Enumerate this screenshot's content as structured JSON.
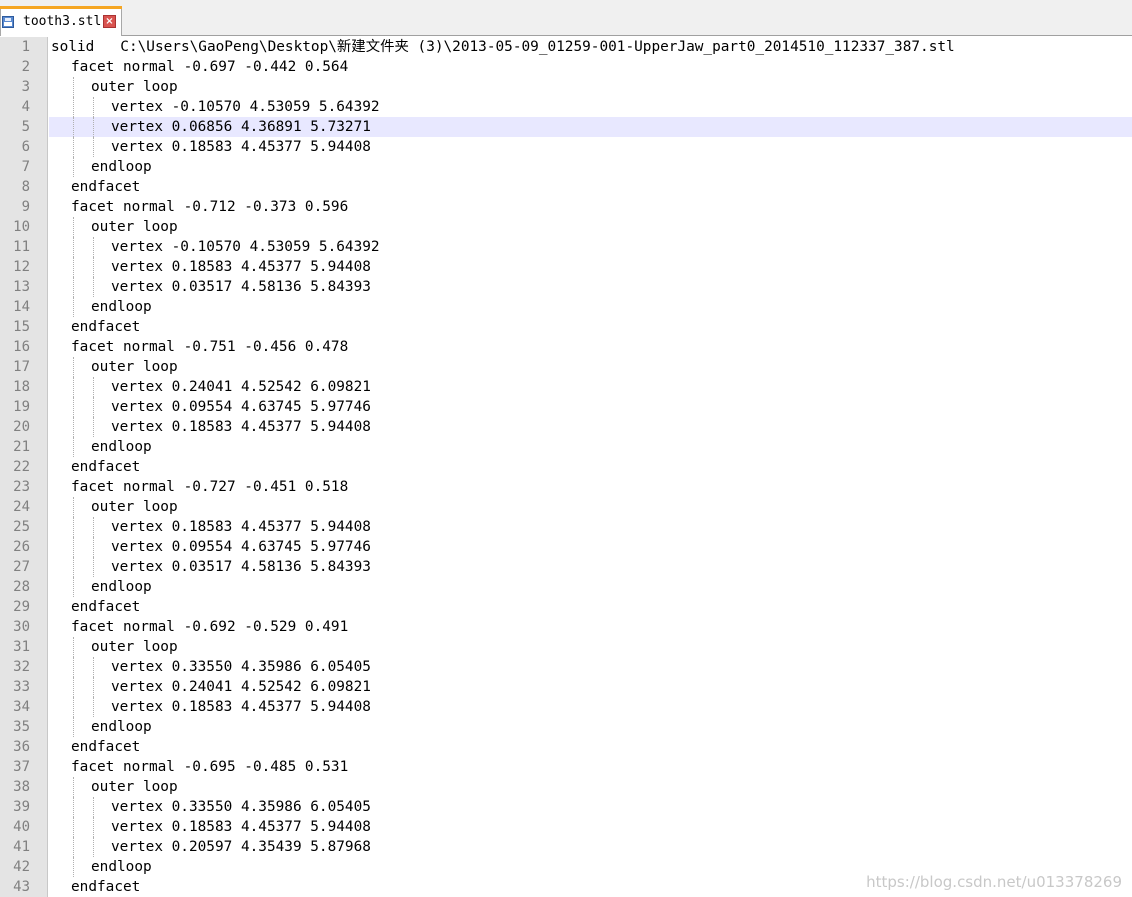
{
  "tab": {
    "label": "tooth3.stl",
    "save_icon": "save-icon",
    "close_icon": "close-icon",
    "accent_color": "#f5a623"
  },
  "editor": {
    "current_line": 5,
    "lines": [
      {
        "n": "1",
        "indent": 0,
        "text": "solid   C:\\Users\\GaoPeng\\Desktop\\新建文件夹 (3)\\2013-05-09_01259-001-UpperJaw_part0_2014510_112337_387.stl"
      },
      {
        "n": "2",
        "indent": 1,
        "text": "facet normal -0.697 -0.442 0.564"
      },
      {
        "n": "3",
        "indent": 2,
        "text": "outer loop"
      },
      {
        "n": "4",
        "indent": 3,
        "text": "vertex -0.10570 4.53059 5.64392"
      },
      {
        "n": "5",
        "indent": 3,
        "text": "vertex 0.06856 4.36891 5.73271"
      },
      {
        "n": "6",
        "indent": 3,
        "text": "vertex 0.18583 4.45377 5.94408"
      },
      {
        "n": "7",
        "indent": 2,
        "text": "endloop"
      },
      {
        "n": "8",
        "indent": 1,
        "text": "endfacet"
      },
      {
        "n": "9",
        "indent": 1,
        "text": "facet normal -0.712 -0.373 0.596"
      },
      {
        "n": "10",
        "indent": 2,
        "text": "outer loop"
      },
      {
        "n": "11",
        "indent": 3,
        "text": "vertex -0.10570 4.53059 5.64392"
      },
      {
        "n": "12",
        "indent": 3,
        "text": "vertex 0.18583 4.45377 5.94408"
      },
      {
        "n": "13",
        "indent": 3,
        "text": "vertex 0.03517 4.58136 5.84393"
      },
      {
        "n": "14",
        "indent": 2,
        "text": "endloop"
      },
      {
        "n": "15",
        "indent": 1,
        "text": "endfacet"
      },
      {
        "n": "16",
        "indent": 1,
        "text": "facet normal -0.751 -0.456 0.478"
      },
      {
        "n": "17",
        "indent": 2,
        "text": "outer loop"
      },
      {
        "n": "18",
        "indent": 3,
        "text": "vertex 0.24041 4.52542 6.09821"
      },
      {
        "n": "19",
        "indent": 3,
        "text": "vertex 0.09554 4.63745 5.97746"
      },
      {
        "n": "20",
        "indent": 3,
        "text": "vertex 0.18583 4.45377 5.94408"
      },
      {
        "n": "21",
        "indent": 2,
        "text": "endloop"
      },
      {
        "n": "22",
        "indent": 1,
        "text": "endfacet"
      },
      {
        "n": "23",
        "indent": 1,
        "text": "facet normal -0.727 -0.451 0.518"
      },
      {
        "n": "24",
        "indent": 2,
        "text": "outer loop"
      },
      {
        "n": "25",
        "indent": 3,
        "text": "vertex 0.18583 4.45377 5.94408"
      },
      {
        "n": "26",
        "indent": 3,
        "text": "vertex 0.09554 4.63745 5.97746"
      },
      {
        "n": "27",
        "indent": 3,
        "text": "vertex 0.03517 4.58136 5.84393"
      },
      {
        "n": "28",
        "indent": 2,
        "text": "endloop"
      },
      {
        "n": "29",
        "indent": 1,
        "text": "endfacet"
      },
      {
        "n": "30",
        "indent": 1,
        "text": "facet normal -0.692 -0.529 0.491"
      },
      {
        "n": "31",
        "indent": 2,
        "text": "outer loop"
      },
      {
        "n": "32",
        "indent": 3,
        "text": "vertex 0.33550 4.35986 6.05405"
      },
      {
        "n": "33",
        "indent": 3,
        "text": "vertex 0.24041 4.52542 6.09821"
      },
      {
        "n": "34",
        "indent": 3,
        "text": "vertex 0.18583 4.45377 5.94408"
      },
      {
        "n": "35",
        "indent": 2,
        "text": "endloop"
      },
      {
        "n": "36",
        "indent": 1,
        "text": "endfacet"
      },
      {
        "n": "37",
        "indent": 1,
        "text": "facet normal -0.695 -0.485 0.531"
      },
      {
        "n": "38",
        "indent": 2,
        "text": "outer loop"
      },
      {
        "n": "39",
        "indent": 3,
        "text": "vertex 0.33550 4.35986 6.05405"
      },
      {
        "n": "40",
        "indent": 3,
        "text": "vertex 0.18583 4.45377 5.94408"
      },
      {
        "n": "41",
        "indent": 3,
        "text": "vertex 0.20597 4.35439 5.87968"
      },
      {
        "n": "42",
        "indent": 2,
        "text": "endloop"
      },
      {
        "n": "43",
        "indent": 1,
        "text": "endfacet"
      }
    ]
  },
  "watermark": "https://blog.csdn.net/u013378269"
}
